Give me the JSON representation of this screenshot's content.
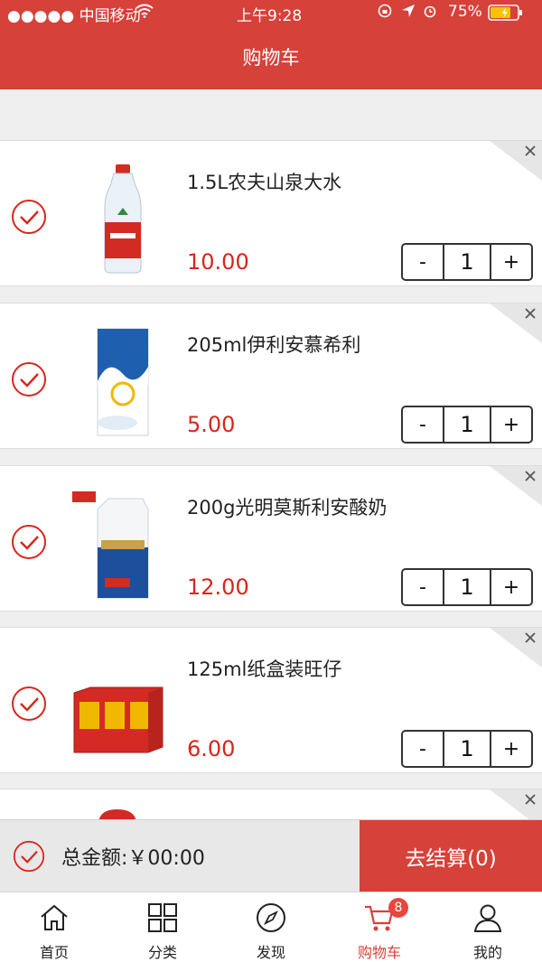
{
  "status_bar": {
    "carrier": "●●●●● 中国移动",
    "time": "上午9:28",
    "battery": "75%"
  },
  "header": {
    "title": "购物车"
  },
  "items": [
    {
      "name": "1.5L农夫山泉大水",
      "price": "10.00",
      "qty": "1"
    },
    {
      "name": "205ml伊利安慕希利",
      "price": "5.00",
      "qty": "1"
    },
    {
      "name": "200g光明莫斯利安酸奶",
      "price": "12.00",
      "qty": "1"
    },
    {
      "name": "125ml纸盒装旺仔",
      "price": "6.00",
      "qty": "1"
    }
  ],
  "stepper": {
    "minus": "-",
    "plus": "+"
  },
  "checkout": {
    "total_label": "总金额:￥00:00",
    "button": "去结算(0)"
  },
  "tabs": [
    {
      "label": "首页",
      "icon": "home-icon"
    },
    {
      "label": "分类",
      "icon": "grid-icon"
    },
    {
      "label": "发现",
      "icon": "compass-icon"
    },
    {
      "label": "购物车",
      "icon": "cart-icon",
      "badge": "8",
      "active": true
    },
    {
      "label": "我的",
      "icon": "user-icon"
    }
  ],
  "colors": {
    "brand": "#d6413a",
    "price": "#d9251c"
  }
}
